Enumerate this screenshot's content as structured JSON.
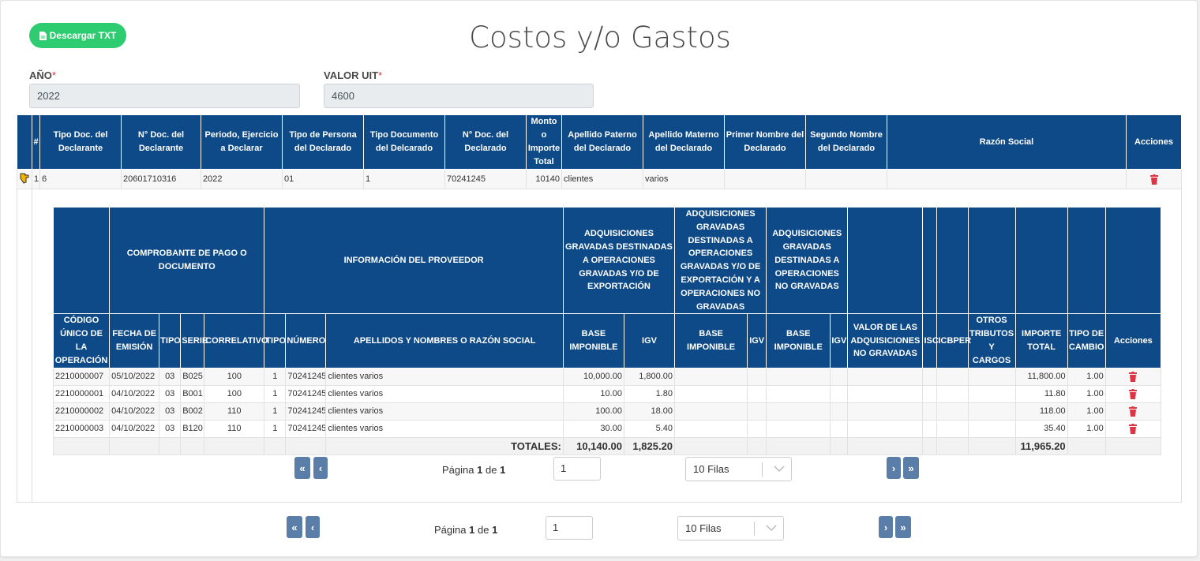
{
  "header": {
    "download_label": "Descargar TXT",
    "title": "Costos y/o Gastos"
  },
  "form": {
    "year_label": "AÑO",
    "year_value": "2022",
    "uit_label": "VALOR UIT",
    "uit_value": "4600",
    "required_mark": "*"
  },
  "main_table": {
    "headers": [
      "#",
      "Tipo Doc. del Declarante",
      "N° Doc. del Declarante",
      "Periodo, Ejercicio a Declarar",
      "Tipo de Persona del Declarado",
      "Tipo Documento del Delcarado",
      "N° Doc. del Declarado",
      "Monto o Importe Total",
      "Apellido Paterno del Declarado",
      "Apellido Materno del Declarado",
      "Primer Nombre del Declarado",
      "Segundo Nombre del Declarado",
      "Razón Social",
      "Acciones"
    ],
    "row": {
      "num": "1",
      "tipo_doc": "6",
      "num_doc": "20601710316",
      "periodo": "2022",
      "tipo_persona": "01",
      "tipo_documento": "1",
      "num_doc_declarado": "70241245",
      "monto": "10140",
      "apellido_paterno": "clientes",
      "apellido_materno": "varios",
      "primer_nombre": "",
      "segundo_nombre": "",
      "razon_social": ""
    }
  },
  "detail_table": {
    "group_headers": {
      "comprobante": "COMPROBANTE DE PAGO O DOCUMENTO",
      "proveedor": "INFORMACIÓN DEL PROVEEDOR",
      "adq_export": "ADQUISICIONES GRAVADAS DESTINADAS A OPERACIONES GRAVADAS Y/O DE EXPORTACIÓN",
      "adq_mixed": "ADQUISICIONES GRAVADAS DESTINADAS A OPERACIONES GRAVADAS Y/O DE EXPORTACIÓN Y A OPERACIONES NO GRAVADAS",
      "adq_no_grav": "ADQUISICIONES GRAVADAS DESTINADAS A OPERACIONES NO GRAVADAS"
    },
    "headers": {
      "codigo": "CÓDIGO ÚNICO DE LA OPERACIÓN",
      "fecha": "FECHA DE EMISIÓN",
      "tipo": "TIPO",
      "serie": "SERIE",
      "correlativo": "CORRELATIVO",
      "tipo_prov": "TIPO",
      "numero": "NÚMERO",
      "nombre": "APELLIDOS Y NOMBRES O RAZÓN SOCIAL",
      "base1": "BASE IMPONIBLE",
      "igv1": "IGV",
      "base2": "BASE IMPONIBLE",
      "igv2": "IGV",
      "base3": "BASE IMPONIBLE",
      "igv3": "IGV",
      "valor_no_grav": "VALOR DE LAS ADQUISICIONES NO GRAVADAS",
      "isc": "ISC",
      "icbper": "ICBPER",
      "otros": "OTROS TRIBUTOS Y CARGOS",
      "importe": "IMPORTE TOTAL",
      "tipo_cambio": "TIPO DE CAMBIO",
      "acciones": "Acciones"
    },
    "rows": [
      {
        "codigo": "2210000007",
        "fecha": "05/10/2022",
        "tipo": "03",
        "serie": "B025",
        "correlativo": "100",
        "tipo_prov": "1",
        "numero": "70241245",
        "nombre": "clientes varios",
        "base1": "10,000.00",
        "igv1": "1,800.00",
        "importe": "11,800.00",
        "tipo_cambio": "1.00"
      },
      {
        "codigo": "2210000001",
        "fecha": "04/10/2022",
        "tipo": "03",
        "serie": "B001",
        "correlativo": "100",
        "tipo_prov": "1",
        "numero": "70241245",
        "nombre": "clientes varios",
        "base1": "10.00",
        "igv1": "1.80",
        "importe": "11.80",
        "tipo_cambio": "1.00"
      },
      {
        "codigo": "2210000002",
        "fecha": "04/10/2022",
        "tipo": "03",
        "serie": "B002",
        "correlativo": "110",
        "tipo_prov": "1",
        "numero": "70241245",
        "nombre": "clientes varios",
        "base1": "100.00",
        "igv1": "18.00",
        "importe": "118.00",
        "tipo_cambio": "1.00"
      },
      {
        "codigo": "2210000003",
        "fecha": "04/10/2022",
        "tipo": "03",
        "serie": "B120",
        "correlativo": "110",
        "tipo_prov": "1",
        "numero": "70241245",
        "nombre": "clientes varios",
        "base1": "30.00",
        "igv1": "5.40",
        "importe": "35.40",
        "tipo_cambio": "1.00"
      }
    ],
    "totals": {
      "label": "TOTALES:",
      "base1": "10,140.00",
      "igv1": "1,825.20",
      "importe": "11,965.20"
    }
  },
  "pagination_inner": {
    "page_word": "Página",
    "current": "1",
    "of_word": "de",
    "total": "1",
    "input_value": "1",
    "rows_option": "10 Filas"
  },
  "pagination_outer": {
    "page_word": "Página",
    "current": "1",
    "of_word": "de",
    "total": "1",
    "input_value": "1",
    "rows_option": "10 Filas"
  },
  "icons": {
    "download": "file-icon",
    "expand": "hand-pointer-icon",
    "delete": "trash-icon",
    "first": "double-chevron-left-icon",
    "prev": "chevron-left-icon",
    "next": "chevron-right-icon",
    "last": "double-chevron-right-icon",
    "select": "chevron-down-icon"
  },
  "colors": {
    "header_bg": "#0e4a87",
    "download_btn": "#2ecc71",
    "delete": "#dc3545",
    "pager_btn": "#5b7ea8"
  }
}
